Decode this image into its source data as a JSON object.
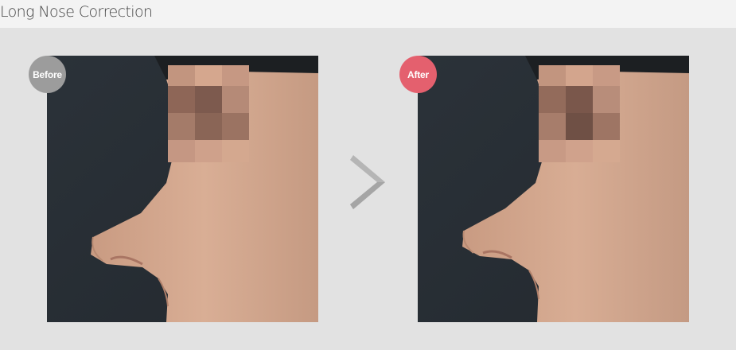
{
  "header": {
    "title": "Long Nose Correction"
  },
  "comparison": {
    "before_label": "Before",
    "after_label": "After"
  },
  "colors": {
    "before_badge": "#9c9c9c",
    "after_badge": "#e4606e",
    "arrow": "#b5b5b5",
    "page_background": "#e2e2e2"
  },
  "icons": {
    "arrow": "chevron-right-icon"
  }
}
